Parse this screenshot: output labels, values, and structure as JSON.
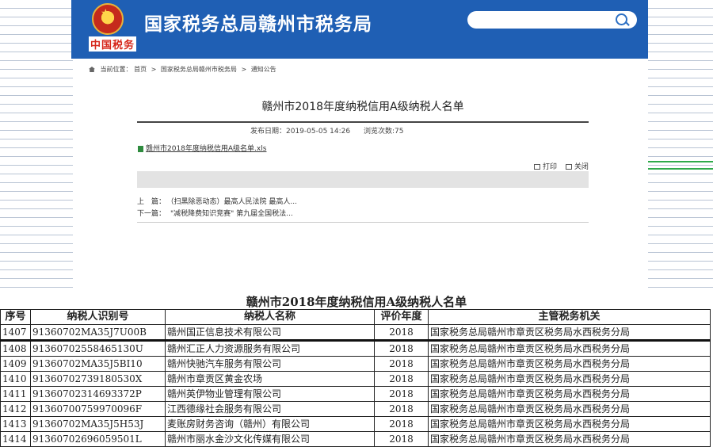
{
  "header": {
    "emblem_caption": "中国税务",
    "site_title": "国家税务总局赣州市税务局",
    "search_placeholder": ""
  },
  "breadcrumb": {
    "label": "当前位置：",
    "items": [
      "首页",
      "国家税务总局赣州市税务局",
      "通知公告"
    ],
    "separator": ">"
  },
  "article": {
    "title": "赣州市2018年度纳税信用A级纳税人名单",
    "publish_date": "发布日期：2019-05-05 14:26",
    "views": "浏览次数:75",
    "attachment": "赣州市2018年度纳税信用A级名单.xls",
    "print_label": "打印",
    "close_label": "关闭",
    "prev_label": "上　篇：",
    "prev_text": "（扫黑除恶动态）最高人民法院 最高人...",
    "next_label": "下一篇：",
    "next_text": "\"减税降费知识竞赛\" 第九届全国税法..."
  },
  "sheet": {
    "title": "赣州市2018年度纳税信用A级纳税人名单",
    "headers": [
      "序号",
      "纳税人识别号",
      "纳税人名称",
      "评价年度",
      "主管税务机关"
    ],
    "rows": [
      [
        "1407",
        "91360702MA35J7U00B",
        "赣州国正信息技术有限公司",
        "2018",
        "国家税务总局赣州市章贡区税务局水西税务分局"
      ],
      [
        "1408",
        "91360702558465130U",
        "赣州汇正人力资源服务有限公司",
        "2018",
        "国家税务总局赣州市章贡区税务局水西税务分局"
      ],
      [
        "1409",
        "91360702MA35J5BI10",
        "赣州快驰汽车服务有限公司",
        "2018",
        "国家税务总局赣州市章贡区税务局水西税务分局"
      ],
      [
        "1410",
        "91360702739180530X",
        "赣州市章贡区黄金农场",
        "2018",
        "国家税务总局赣州市章贡区税务局水西税务分局"
      ],
      [
        "1411",
        "91360702314693372P",
        "赣州英伊物业管理有限公司",
        "2018",
        "国家税务总局赣州市章贡区税务局水西税务分局"
      ],
      [
        "1412",
        "91360700759970096F",
        "江西德缘社会服务有限公司",
        "2018",
        "国家税务总局赣州市章贡区税务局水西税务分局"
      ],
      [
        "1413",
        "91360702MA35J5H53J",
        "麦账房财务咨询（赣州）有限公司",
        "2018",
        "国家税务总局赣州市章贡区税务局水西税务分局"
      ],
      [
        "1414",
        "91360702696059501L",
        "赣州市丽水金沙文化传媒有限公司",
        "2018",
        "国家税务总局赣州市章贡区税务局水西税务分局"
      ]
    ]
  },
  "colors": {
    "header_bg": "#1f5fb4",
    "accent_green": "#2eaa4a"
  }
}
